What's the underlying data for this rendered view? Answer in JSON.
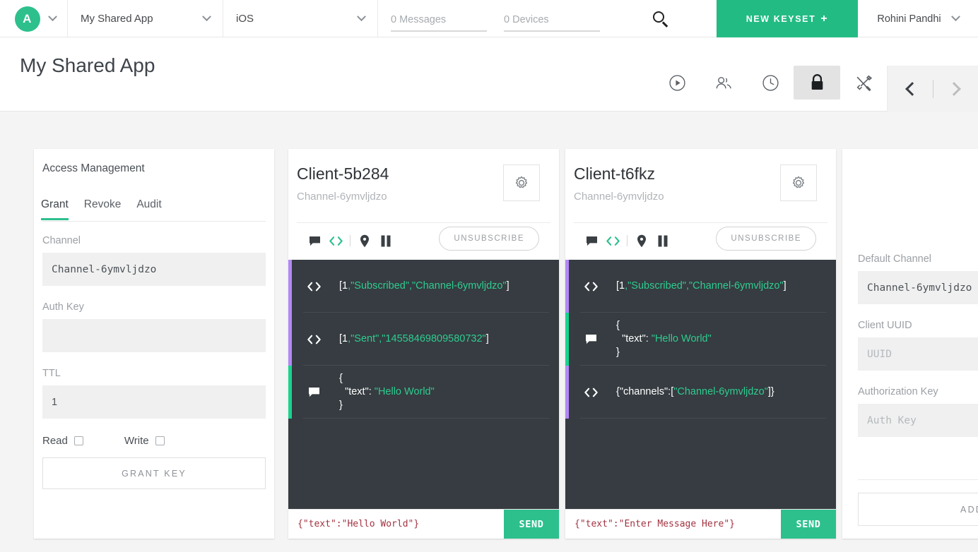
{
  "topbar": {
    "avatar_letter": "A",
    "app_select": "My Shared App",
    "platform_select": "iOS",
    "messages_field": "0 Messages",
    "devices_field": "0 Devices",
    "new_keyset_label": "NEW KEYSET",
    "new_keyset_plus": "+",
    "user_name": "Rohini Pandhi"
  },
  "page": {
    "title": "My Shared App",
    "toolbar_icons": [
      "play-circle-icon",
      "people-icon",
      "clock-icon",
      "lock-icon",
      "tools-icon"
    ],
    "active_tool": "lock-icon"
  },
  "access_management": {
    "title": "Access Management",
    "tabs": [
      {
        "label": "Grant",
        "active": true
      },
      {
        "label": "Revoke",
        "active": false
      },
      {
        "label": "Audit",
        "active": false
      }
    ],
    "channel_label": "Channel",
    "channel_value": "Channel-6ymvljdzo",
    "authkey_label": "Auth Key",
    "authkey_value": "",
    "ttl_label": "TTL",
    "ttl_value": "1",
    "read_label": "Read",
    "write_label": "Write",
    "grant_button": "GRANT KEY"
  },
  "clients": [
    {
      "name": "Client-5b284",
      "channel": "Channel-6ymvljdzo",
      "unsubscribe_label": "UNSUBSCRIBE",
      "send_value": "{\"text\":\"Hello World\"}",
      "send_label": "SEND",
      "messages": [
        {
          "icon": "code-icon",
          "bar": "#b388f5",
          "parts": [
            {
              "t": "[",
              "c": "w"
            },
            {
              "t": "1",
              "c": "w"
            },
            {
              "t": ",\"Subscribed\",\"Channel-6ymvljdzo\"",
              "c": "g"
            },
            {
              "t": "]",
              "c": "w"
            }
          ]
        },
        {
          "icon": "code-icon",
          "bar": "#b388f5",
          "parts": [
            {
              "t": "[",
              "c": "w"
            },
            {
              "t": "1",
              "c": "w"
            },
            {
              "t": ",\"Sent\",\"14558469809580732\"",
              "c": "g"
            },
            {
              "t": "]",
              "c": "w"
            }
          ]
        },
        {
          "icon": "chat-icon",
          "bar": "#17d58f",
          "parts": [
            {
              "t": "{\n  ",
              "c": "w"
            },
            {
              "t": "\"text\"",
              "c": "w"
            },
            {
              "t": ": ",
              "c": "w"
            },
            {
              "t": "\"Hello World\"",
              "c": "g"
            },
            {
              "t": "\n}",
              "c": "w"
            }
          ]
        }
      ]
    },
    {
      "name": "Client-t6fkz",
      "channel": "Channel-6ymvljdzo",
      "unsubscribe_label": "UNSUBSCRIBE",
      "send_value": "{\"text\":\"Enter Message Here\"}",
      "send_label": "SEND",
      "messages": [
        {
          "icon": "code-icon",
          "bar": "#b388f5",
          "parts": [
            {
              "t": "[",
              "c": "w"
            },
            {
              "t": "1",
              "c": "w"
            },
            {
              "t": ",\"Subscribed\",\"Channel-6ymvljdzo\"",
              "c": "g"
            },
            {
              "t": "]",
              "c": "w"
            }
          ]
        },
        {
          "icon": "chat-icon",
          "bar": "#17d58f",
          "parts": [
            {
              "t": "{\n  ",
              "c": "w"
            },
            {
              "t": "\"text\"",
              "c": "w"
            },
            {
              "t": ": ",
              "c": "w"
            },
            {
              "t": "\"Hello World\"",
              "c": "g"
            },
            {
              "t": "\n}",
              "c": "w"
            }
          ]
        },
        {
          "icon": "code-icon",
          "bar": "#b388f5",
          "parts": [
            {
              "t": "{\"channels\":[",
              "c": "w"
            },
            {
              "t": "\"Channel-6ymvljdzo\"",
              "c": "g"
            },
            {
              "t": "]}",
              "c": "w"
            }
          ]
        }
      ]
    }
  ],
  "new_client_card": {
    "default_channel_label": "Default Channel",
    "default_channel_value": "Channel-6ymvljdzo",
    "client_uuid_label": "Client UUID",
    "client_uuid_placeholder": "UUID",
    "auth_key_label": "Authorization Key",
    "auth_key_placeholder": "Auth Key",
    "add_button": "ADD C"
  },
  "colors": {
    "brand_green": "#2dc08d",
    "keyset_green": "#23bb84",
    "console_bg": "#363c41",
    "bar_purple": "#b388f5",
    "bar_green": "#17d58f",
    "json_red": "#a23341"
  }
}
